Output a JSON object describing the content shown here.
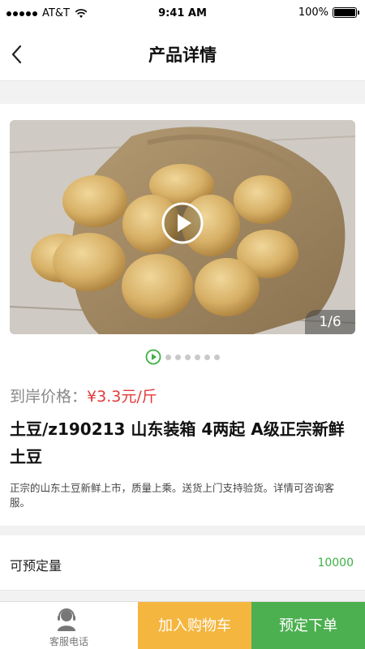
{
  "status_bar": {
    "carrier": "AT&T",
    "time": "9:41 AM",
    "battery": "100%",
    "icons": [
      "signal-dots-icon",
      "wifi-icon",
      "battery-icon"
    ]
  },
  "nav": {
    "title": "产品详情",
    "back_icon": "chevron-left-icon"
  },
  "gallery": {
    "counter": "1/6",
    "total_images": 6,
    "current_index": 1,
    "play_icon": "play-circle-icon"
  },
  "product": {
    "price_label": "到岸价格：",
    "price_value": "¥3.3元/斤",
    "title": "土豆/z190213 山东装箱 4两起 A级正宗新鲜土豆",
    "description": "正宗的山东土豆新鲜上市，质量上乘。送货上门支持验货。详情可咨询客服。"
  },
  "stock": {
    "label": "可预定量",
    "value": "10000"
  },
  "bottom_bar": {
    "service_label": "客服电话",
    "cart_label": "加入购物车",
    "order_label": "预定下单"
  },
  "colors": {
    "price": "#e23b3b",
    "stock_value": "#3cb043",
    "cart_button": "#f5b63f",
    "order_button": "#4caf50",
    "indicator_active": "#3cb043"
  }
}
